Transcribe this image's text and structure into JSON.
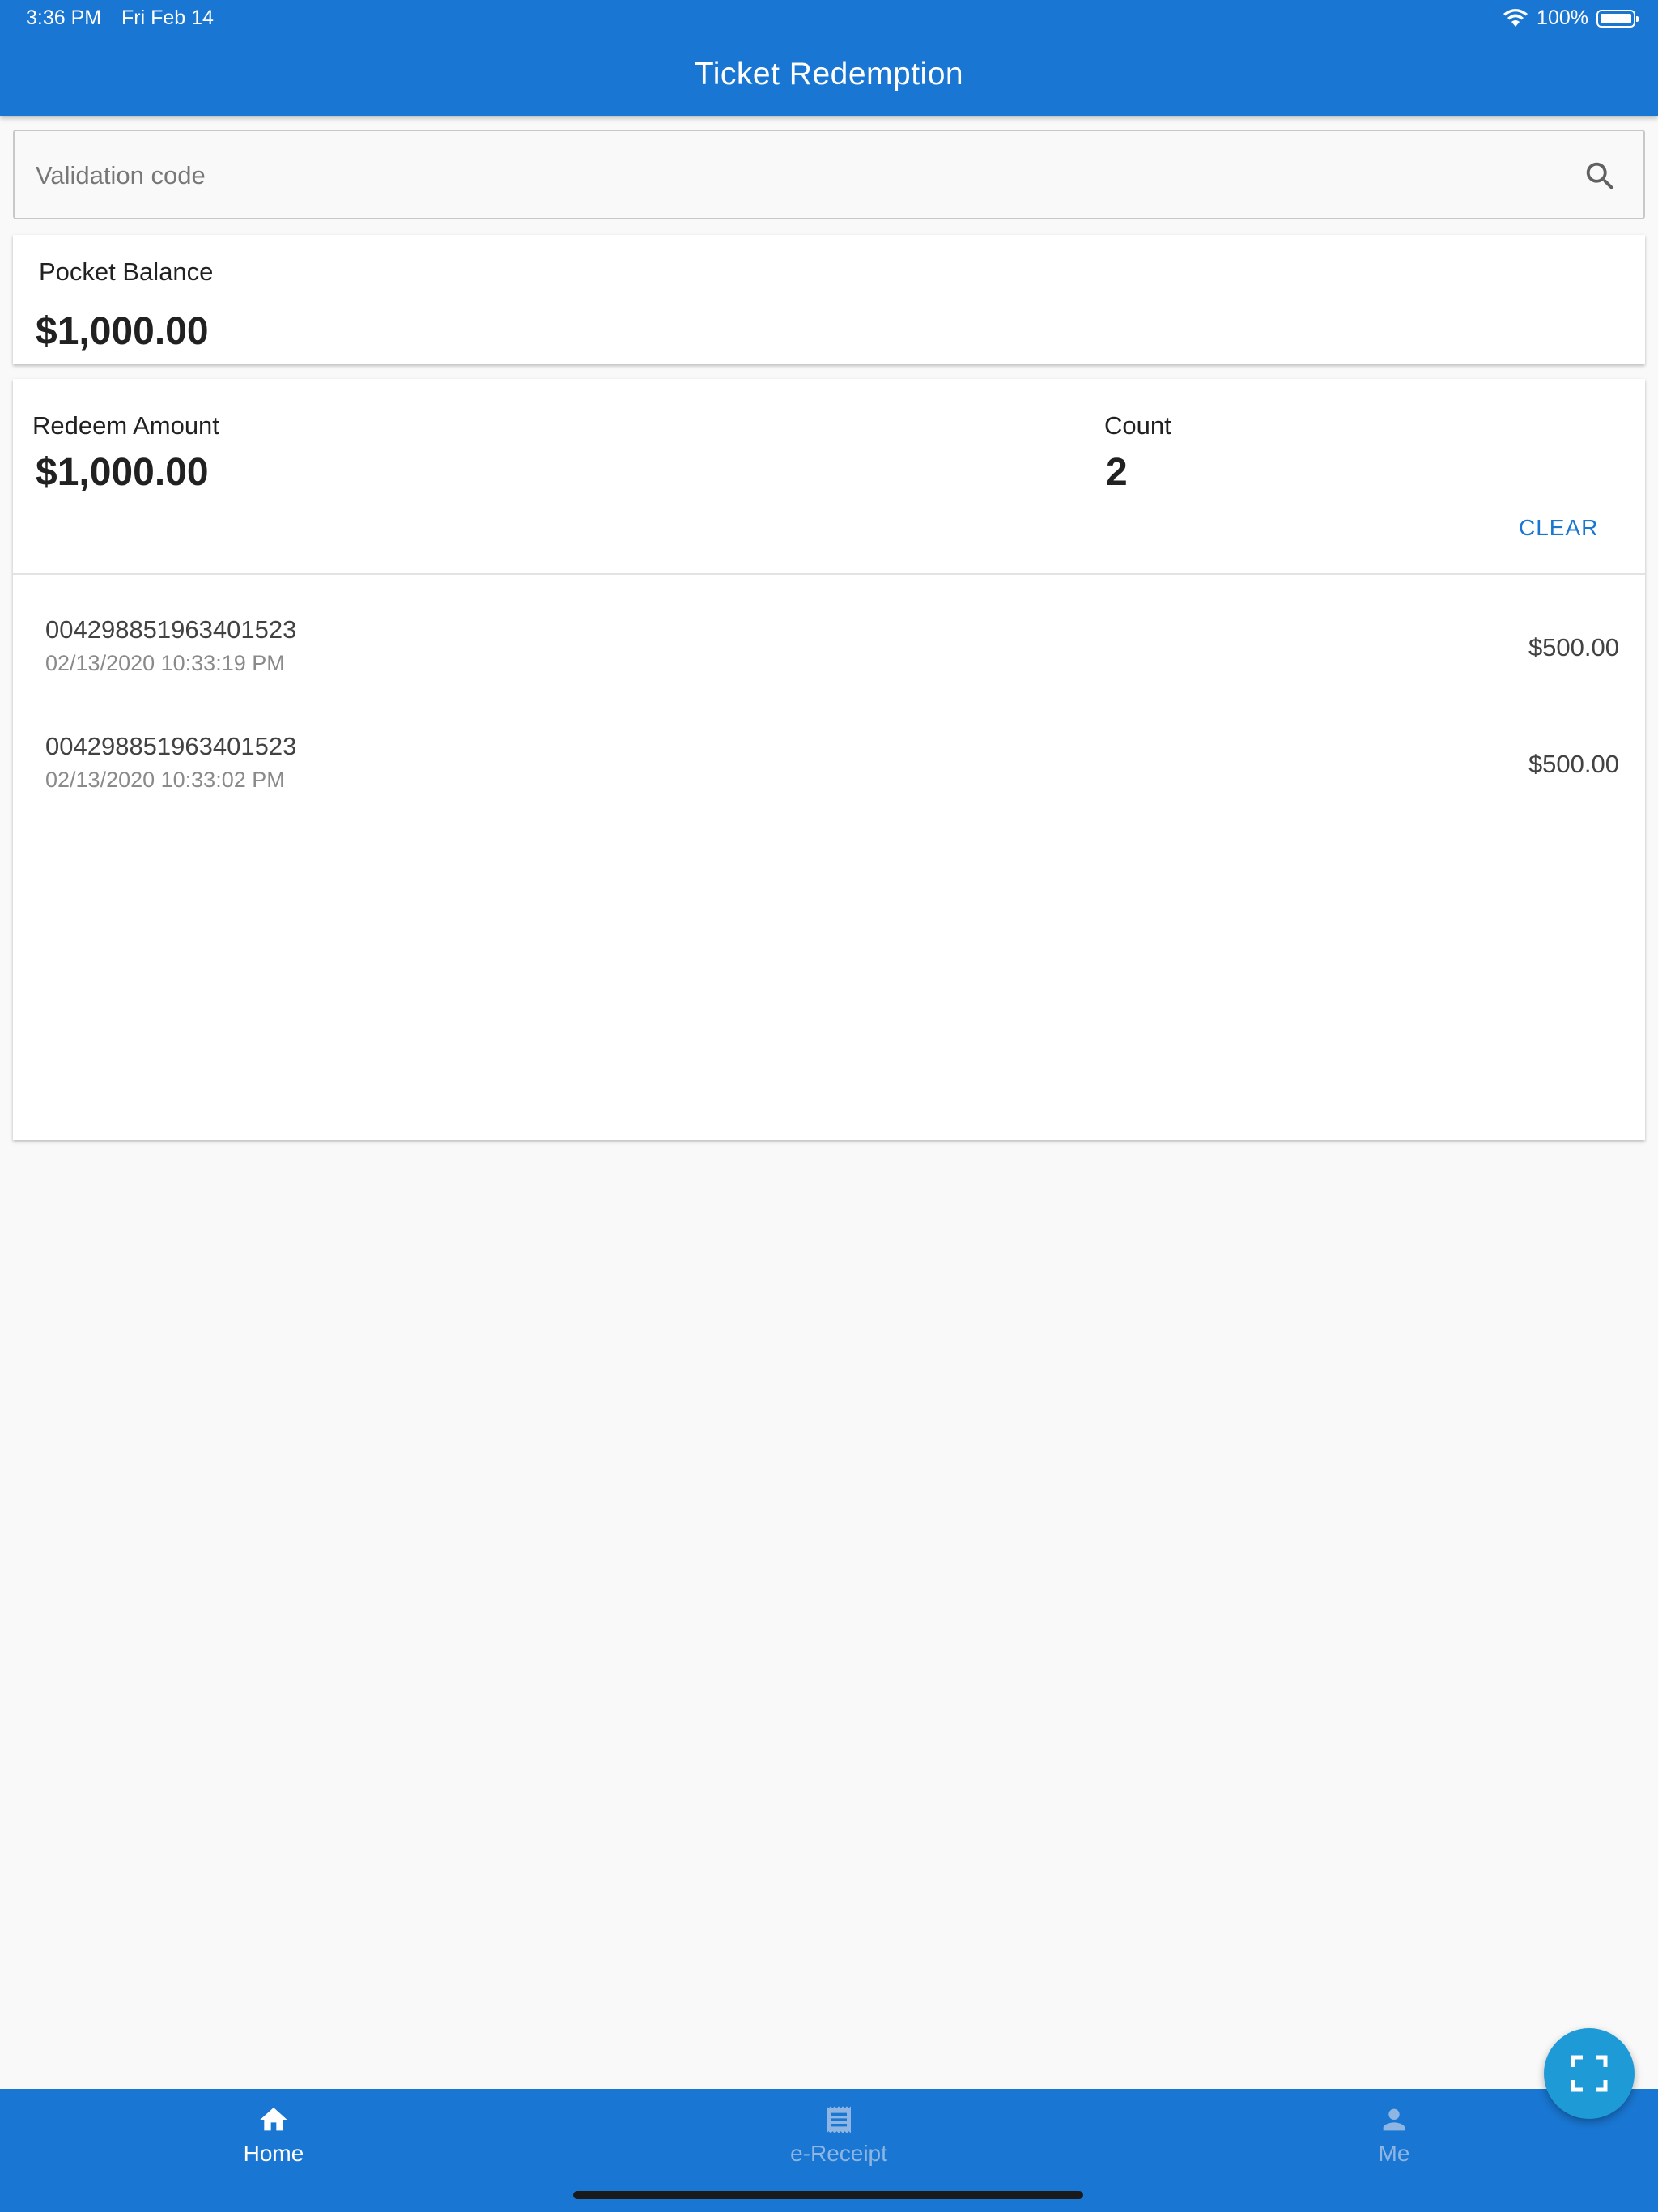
{
  "status_bar": {
    "time": "3:36 PM",
    "date": "Fri Feb 14",
    "battery": "100%"
  },
  "app_bar": {
    "title": "Ticket Redemption"
  },
  "search": {
    "placeholder": "Validation code",
    "value": "",
    "icon": "search-icon"
  },
  "pocket_balance": {
    "label": "Pocket Balance",
    "amount": "$1,000.00"
  },
  "redeem": {
    "amount_label": "Redeem Amount",
    "amount": "$1,000.00",
    "count_label": "Count",
    "count": "2",
    "clear_label": "CLEAR",
    "items": [
      {
        "code": "004298851963401523",
        "datetime": "02/13/2020 10:33:19 PM",
        "amount": "$500.00"
      },
      {
        "code": "004298851963401523",
        "datetime": "02/13/2020 10:33:02 PM",
        "amount": "$500.00"
      }
    ]
  },
  "fab": {
    "icon": "scan-icon"
  },
  "bottom_nav": {
    "items": [
      {
        "label": "Home",
        "icon": "home-icon",
        "active": true
      },
      {
        "label": "e-Receipt",
        "icon": "receipt-icon",
        "active": false
      },
      {
        "label": "Me",
        "icon": "person-icon",
        "active": false
      }
    ]
  },
  "colors": {
    "primary": "#1976d2",
    "fab": "#1e9bd7",
    "background": "#f9f9f9"
  }
}
